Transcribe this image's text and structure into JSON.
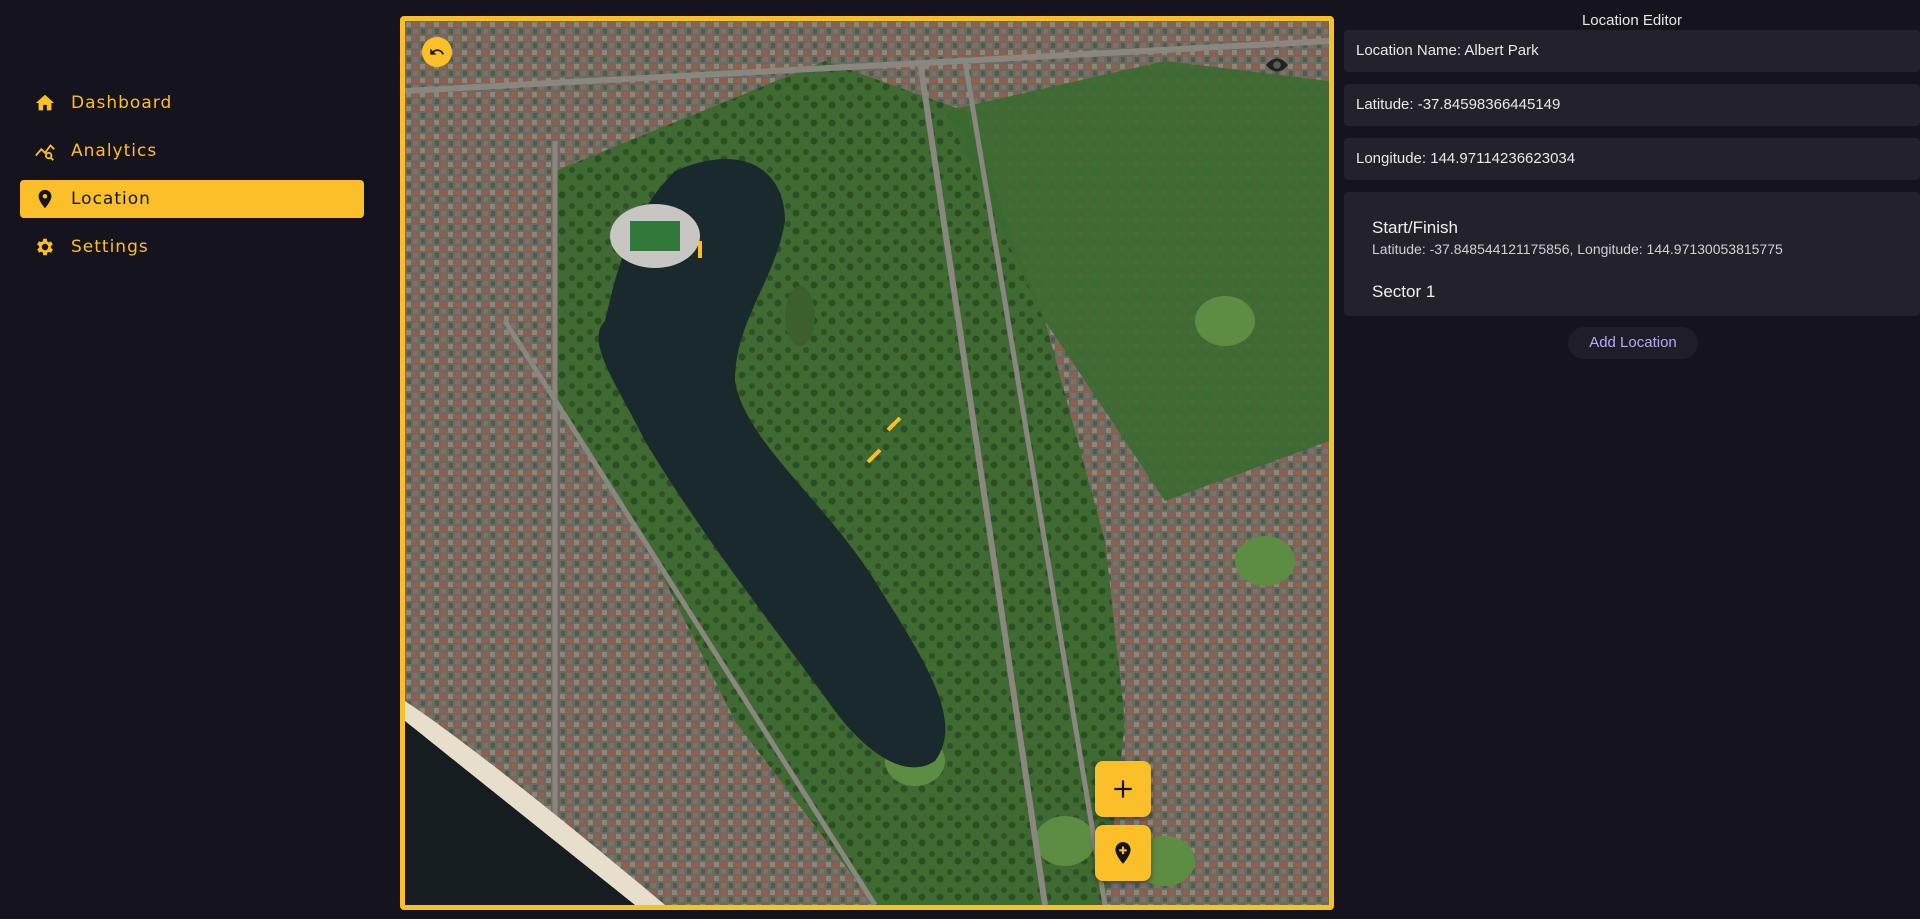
{
  "sidebar": {
    "items": [
      {
        "label": "Dashboard",
        "icon": "home-icon",
        "active": false
      },
      {
        "label": "Analytics",
        "icon": "analytics-icon",
        "active": false
      },
      {
        "label": "Location",
        "icon": "location-pin-icon",
        "active": true
      },
      {
        "label": "Settings",
        "icon": "gear-icon",
        "active": false
      }
    ]
  },
  "map": {
    "undo_icon": "undo-icon",
    "add_button_icon": "plus-icon",
    "add_marker_icon": "add-location-pin-icon",
    "marker_color": "#fbbf28"
  },
  "editor": {
    "title": "Location Editor",
    "location_name": "Location Name: Albert Park",
    "latitude": "Latitude: -37.84598366445149",
    "longitude": "Longitude: 144.97114236623034",
    "entries": [
      {
        "title": "Start/Finish",
        "subtitle": "Latitude: -37.848544121175856, Longitude: 144.97130053815775"
      },
      {
        "title": "Sector 1",
        "subtitle": ""
      }
    ],
    "add_label": "Add Location"
  },
  "colors": {
    "accent": "#fbbf28",
    "background": "#15141d",
    "panel": "#23222b",
    "link": "#b7a6ff"
  }
}
